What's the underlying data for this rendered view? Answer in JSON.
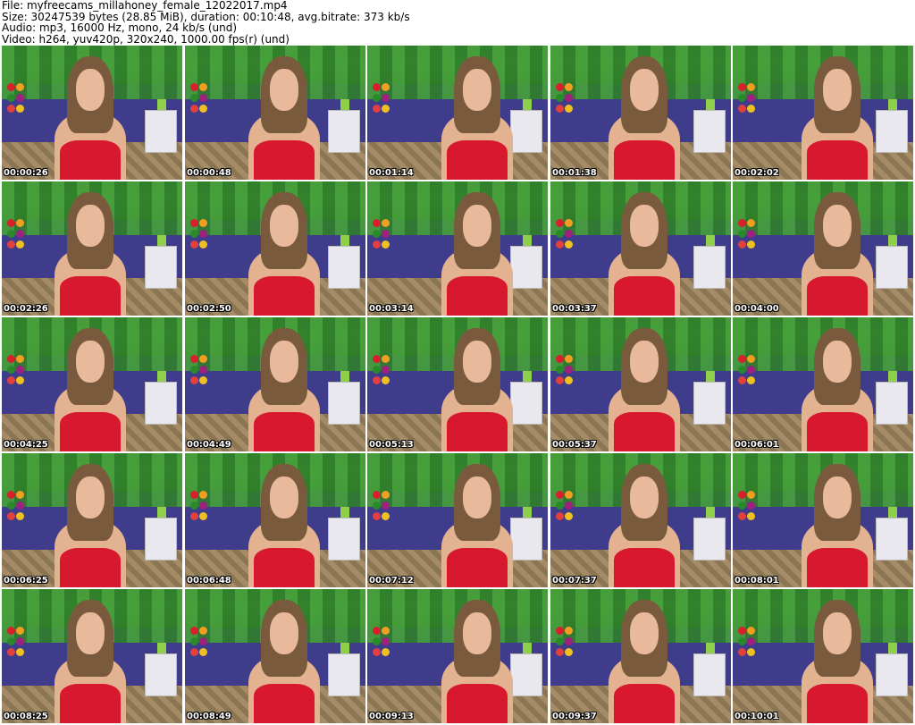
{
  "header": {
    "file_line": "File: myfreecams_millahoney_female_12022017.mp4",
    "size_line": "Size: 30247539 bytes (28.85 MiB), duration: 00:10:48, avg.bitrate: 373 kb/s",
    "audio_line": "Audio: mp3, 16000 Hz, mono, 24 kb/s (und)",
    "video_line": "Video: h264, yuv420p, 320x240, 1000.00 fps(r) (und)"
  },
  "thumbnails": [
    "00:00:26",
    "00:00:48",
    "00:01:14",
    "00:01:38",
    "00:02:02",
    "00:02:26",
    "00:02:50",
    "00:03:14",
    "00:03:37",
    "00:04:00",
    "00:04:25",
    "00:04:49",
    "00:05:13",
    "00:05:37",
    "00:06:01",
    "00:06:25",
    "00:06:48",
    "00:07:12",
    "00:07:37",
    "00:08:01",
    "00:08:25",
    "00:08:49",
    "00:09:13",
    "00:09:37",
    "00:10:01"
  ]
}
